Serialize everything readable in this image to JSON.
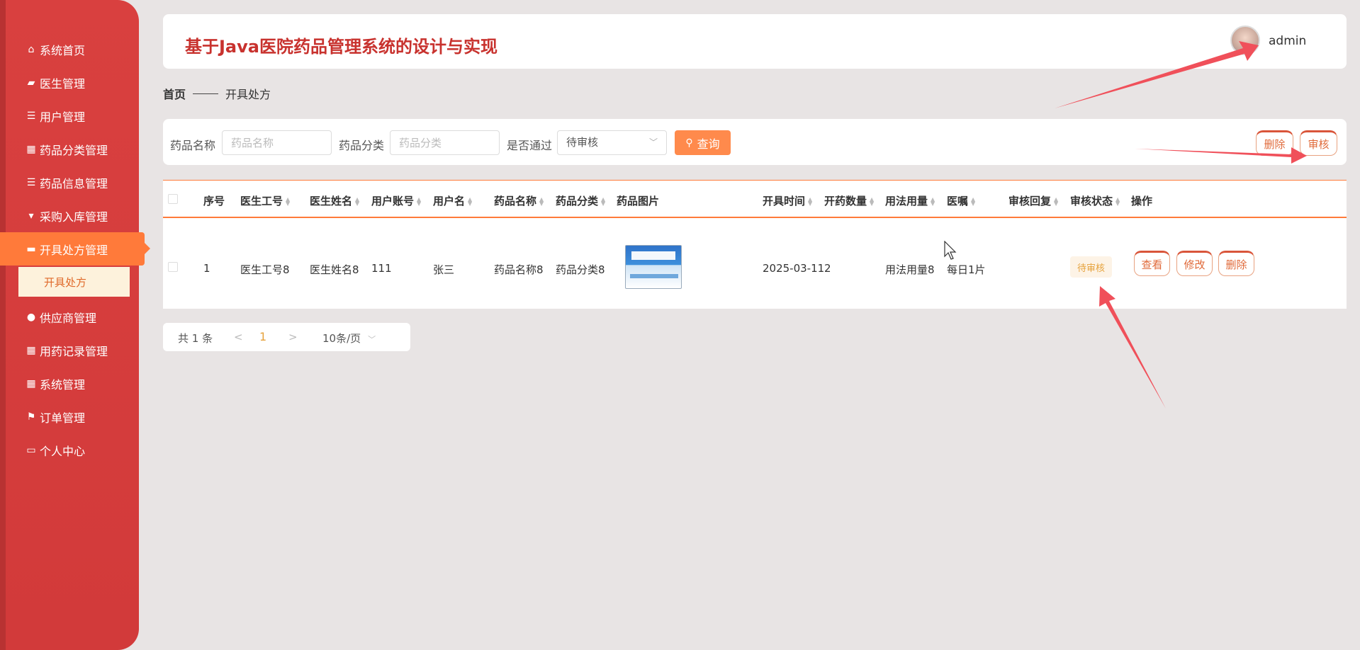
{
  "sidebar": {
    "items": [
      {
        "label": "系统首页",
        "icon": "home-icon"
      },
      {
        "label": "医生管理",
        "icon": "wallet-icon"
      },
      {
        "label": "用户管理",
        "icon": "list-icon"
      },
      {
        "label": "药品分类管理",
        "icon": "grid-icon"
      },
      {
        "label": "药品信息管理",
        "icon": "list-icon"
      },
      {
        "label": "采购入库管理",
        "icon": "bookmark-icon"
      },
      {
        "label": "开具处方管理",
        "icon": "chat-icon"
      },
      {
        "label": "供应商管理",
        "icon": "user-icon"
      },
      {
        "label": "用药记录管理",
        "icon": "grid-icon"
      },
      {
        "label": "系统管理",
        "icon": "grid-icon"
      },
      {
        "label": "订单管理",
        "icon": "flag-icon"
      },
      {
        "label": "个人中心",
        "icon": "card-icon"
      }
    ],
    "active_sub": "开具处方"
  },
  "header": {
    "title": "基于Java医院药品管理系统的设计与实现",
    "username": "admin"
  },
  "breadcrumb": {
    "home": "首页",
    "current": "开具处方"
  },
  "search": {
    "name_label": "药品名称",
    "name_placeholder": "药品名称",
    "category_label": "药品分类",
    "category_placeholder": "药品分类",
    "approved_label": "是否通过",
    "approved_value": "待审核",
    "query_label": "查询",
    "delete_label": "删除",
    "audit_label": "审核"
  },
  "table": {
    "columns": [
      "序号",
      "医生工号",
      "医生姓名",
      "用户账号",
      "用户名",
      "药品名称",
      "药品分类",
      "药品图片",
      "开具时间",
      "开药数量",
      "用法用量",
      "医嘱",
      "审核回复",
      "审核状态",
      "操作"
    ],
    "rows": [
      {
        "index": "1",
        "doctor_no": "医生工号8",
        "doctor_name": "医生姓名8",
        "user_account": "111",
        "user_name": "张三",
        "drug_name": "药品名称8",
        "drug_category": "药品分类8",
        "issue_time": "2025-03-11",
        "quantity": "2",
        "usage": "用法用量8",
        "advice": "每日1片",
        "audit_reply": "",
        "audit_status": "待审核",
        "view_label": "查看",
        "edit_label": "修改",
        "delete_label": "删除"
      }
    ]
  },
  "pagination": {
    "total": "共 1 条",
    "prev": "<",
    "page": "1",
    "next": ">",
    "page_size": "10条/页"
  },
  "colors": {
    "sidebar": "#d9403f",
    "accent": "#ff7a3a",
    "title": "#c8322e",
    "annotation": "#f0505a"
  }
}
